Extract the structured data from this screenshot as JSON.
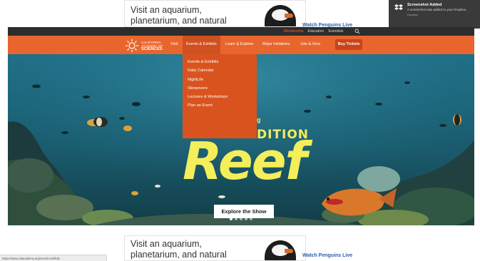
{
  "ad": {
    "text": "Visit an aquarium, planetarium, and natural history museum—",
    "link": "Watch Penguins Live"
  },
  "notification": {
    "title": "Screenshot Added",
    "body": "A screenshot was added to your Dropbox.",
    "time": "Dropbox"
  },
  "utility_bar": {
    "links": [
      "Membership",
      "Educators",
      "Scientists"
    ]
  },
  "logo": {
    "line1": "CALIFORNIA",
    "line2": "ACADEMY OF",
    "line3": "SCIENCES"
  },
  "nav": {
    "items": [
      "Visit",
      "Events & Exhibits",
      "Learn & Explore",
      "Major Initiatives",
      "Join & Give"
    ],
    "buy_tickets": "Buy Tickets"
  },
  "dropdown": {
    "items": [
      "Events & Exhibits",
      "Daily Calendar",
      "NightLife",
      "Sleepovers",
      "Lectures & Workshops",
      "Plan an Event"
    ]
  },
  "hero": {
    "kicker": "g",
    "edition": "DITION",
    "title": "Reef",
    "cta": "Explore the Show",
    "slides_total": 5,
    "slide_active": 1
  },
  "status_bar": {
    "url": "https://www.calacademy.org/events-exhibits"
  },
  "colors": {
    "nav_orange": "#e8662e",
    "dropdown_orange": "#d9531f",
    "hero_yellow": "#f3ee5a",
    "util_dark": "#2d2d2d"
  }
}
